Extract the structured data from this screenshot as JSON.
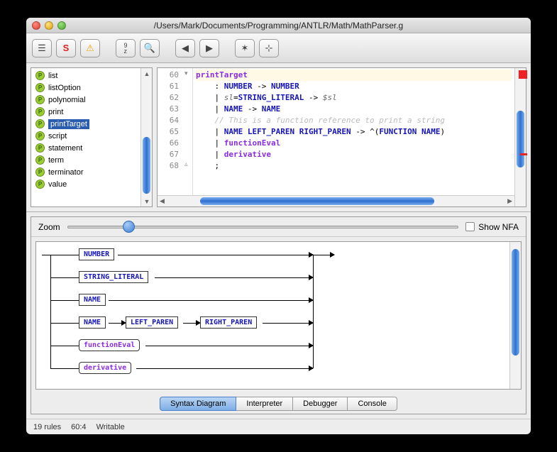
{
  "title": "/Users/Mark/Documents/Programming/ANTLR/Math/MathParser.g",
  "sidebar": {
    "items": [
      {
        "label": "list"
      },
      {
        "label": "listOption"
      },
      {
        "label": "polynomial"
      },
      {
        "label": "print"
      },
      {
        "label": "printTarget"
      },
      {
        "label": "script"
      },
      {
        "label": "statement"
      },
      {
        "label": "term"
      },
      {
        "label": "terminator"
      },
      {
        "label": "value"
      }
    ],
    "selectedIndex": 4
  },
  "editor": {
    "startLine": 60,
    "lines": [
      {
        "n": 60,
        "hl": true,
        "html": "<span class='kw'>printTarget</span>"
      },
      {
        "n": 61,
        "html": "    : <span class='tok'>NUMBER</span> -> <span class='tok'>NUMBER</span>"
      },
      {
        "n": 62,
        "html": "    | <span class='varref'>sl</span>=<span class='tok'>STRING_LITERAL</span> -> <span class='varref'>$sl</span>"
      },
      {
        "n": 63,
        "html": "    | <span class='tok'>NAME</span> -> <span class='tok'>NAME</span>"
      },
      {
        "n": 64,
        "html": "    <span class='cmt'>// This is a function reference to print a string</span>"
      },
      {
        "n": 65,
        "html": "    | <span class='tok'>NAME</span> <span class='tok'>LEFT_PAREN</span> <span class='tok'>RIGHT_PAREN</span> -> ^(<span class='tok'>FUNCTION</span> <span class='tok'>NAME</span>)"
      },
      {
        "n": 66,
        "html": "    | <span class='kw'>functionEval</span>"
      },
      {
        "n": 67,
        "html": "    | <span class='kw'>derivative</span>"
      },
      {
        "n": 68,
        "html": "    ;"
      }
    ]
  },
  "zoom": {
    "label": "Zoom",
    "showNfaLabel": "Show NFA",
    "showNfa": false
  },
  "diagram": {
    "branches": [
      [
        {
          "t": "NUMBER",
          "k": "tok"
        }
      ],
      [
        {
          "t": "STRING_LITERAL",
          "k": "tok"
        }
      ],
      [
        {
          "t": "NAME",
          "k": "tok"
        }
      ],
      [
        {
          "t": "NAME",
          "k": "tok"
        },
        {
          "t": "LEFT_PAREN",
          "k": "tok"
        },
        {
          "t": "RIGHT_PAREN",
          "k": "tok"
        }
      ],
      [
        {
          "t": "functionEval",
          "k": "rule"
        }
      ],
      [
        {
          "t": "derivative",
          "k": "rule"
        }
      ]
    ]
  },
  "tabs": {
    "items": [
      "Syntax Diagram",
      "Interpreter",
      "Debugger",
      "Console"
    ],
    "active": 0
  },
  "status": {
    "rules": "19 rules",
    "pos": "60:4",
    "mode": "Writable"
  }
}
